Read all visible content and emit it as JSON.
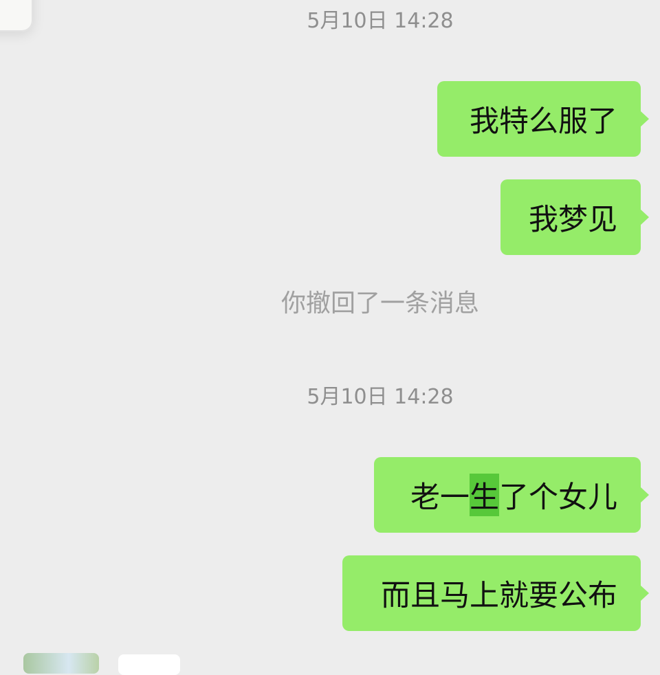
{
  "chat": {
    "timestamps": [
      "5月10日 14:28",
      "5月10日 14:28"
    ],
    "system_messages": [
      "你撤回了一条消息"
    ],
    "messages": [
      {
        "text": "我特么服了"
      },
      {
        "text": "我梦见"
      },
      {
        "text_before": "老一",
        "text_highlight": "生",
        "text_after": "了个女儿"
      },
      {
        "text": "而且马上就要公布"
      }
    ]
  },
  "colors": {
    "background": "#ededed",
    "outgoing_bubble": "#95ec69",
    "selection_highlight": "#57c83a",
    "timestamp_text": "#8e8e8e"
  },
  "icons": [
    "avatar",
    "image-thumbnail"
  ]
}
